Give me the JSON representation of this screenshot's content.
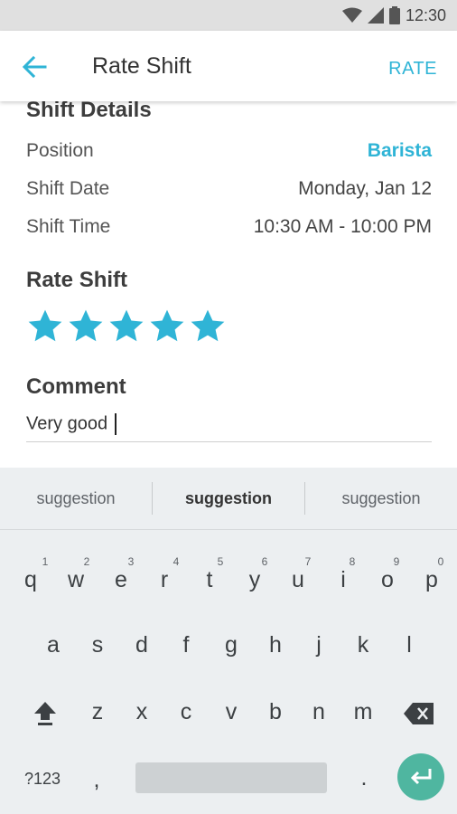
{
  "status_bar": {
    "time": "12:30",
    "icons": [
      "wifi-icon",
      "signal-icon",
      "battery-icon"
    ]
  },
  "app_bar": {
    "title": "Rate Shift",
    "action_label": "RATE",
    "back_icon": "arrow-back-icon"
  },
  "shift_details": {
    "title": "Shift Details",
    "rows": [
      {
        "label": "Position",
        "value": "Barista"
      },
      {
        "label": "Shift Date",
        "value": "Monday, Jan 12"
      },
      {
        "label": "Shift Time",
        "value": "10:30 AM - 10:00 PM"
      }
    ]
  },
  "rating": {
    "title": "Rate Shift",
    "stars": 5,
    "max": 5
  },
  "comment": {
    "title": "Comment",
    "value": "Very good"
  },
  "keyboard": {
    "suggestions": [
      "suggestion",
      "suggestion",
      "suggestion"
    ],
    "row1": [
      "q",
      "w",
      "e",
      "r",
      "t",
      "y",
      "u",
      "i",
      "o",
      "p"
    ],
    "row1_numbers": [
      "1",
      "2",
      "3",
      "4",
      "5",
      "6",
      "7",
      "8",
      "9",
      "0"
    ],
    "row2": [
      "a",
      "s",
      "d",
      "f",
      "g",
      "h",
      "j",
      "k",
      "l"
    ],
    "row3": [
      "z",
      "x",
      "c",
      "v",
      "b",
      "n",
      "m"
    ],
    "symbols_key": "?123",
    "comma_key": ",",
    "period_key": "."
  },
  "colors": {
    "accent": "#2fb4d6",
    "enter": "#4fb6a0",
    "star": "#2fb4d6"
  }
}
